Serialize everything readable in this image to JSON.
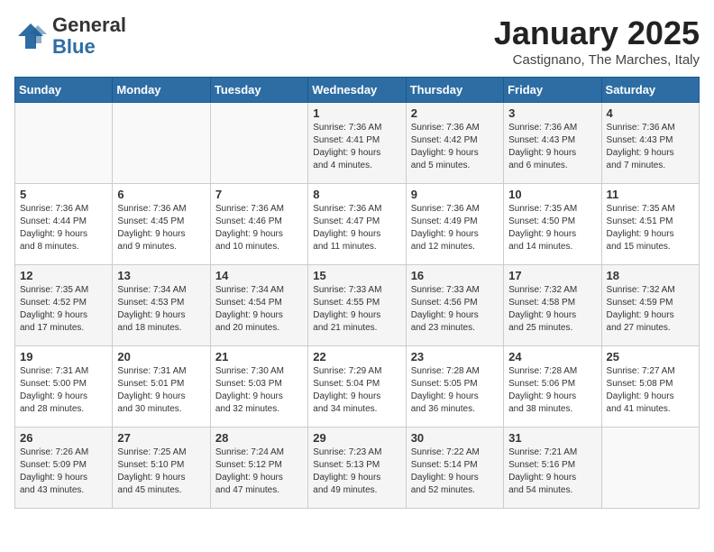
{
  "header": {
    "logo_general": "General",
    "logo_blue": "Blue",
    "month": "January 2025",
    "location": "Castignano, The Marches, Italy"
  },
  "weekdays": [
    "Sunday",
    "Monday",
    "Tuesday",
    "Wednesday",
    "Thursday",
    "Friday",
    "Saturday"
  ],
  "weeks": [
    [
      {
        "day": "",
        "text": ""
      },
      {
        "day": "",
        "text": ""
      },
      {
        "day": "",
        "text": ""
      },
      {
        "day": "1",
        "text": "Sunrise: 7:36 AM\nSunset: 4:41 PM\nDaylight: 9 hours\nand 4 minutes."
      },
      {
        "day": "2",
        "text": "Sunrise: 7:36 AM\nSunset: 4:42 PM\nDaylight: 9 hours\nand 5 minutes."
      },
      {
        "day": "3",
        "text": "Sunrise: 7:36 AM\nSunset: 4:43 PM\nDaylight: 9 hours\nand 6 minutes."
      },
      {
        "day": "4",
        "text": "Sunrise: 7:36 AM\nSunset: 4:43 PM\nDaylight: 9 hours\nand 7 minutes."
      }
    ],
    [
      {
        "day": "5",
        "text": "Sunrise: 7:36 AM\nSunset: 4:44 PM\nDaylight: 9 hours\nand 8 minutes."
      },
      {
        "day": "6",
        "text": "Sunrise: 7:36 AM\nSunset: 4:45 PM\nDaylight: 9 hours\nand 9 minutes."
      },
      {
        "day": "7",
        "text": "Sunrise: 7:36 AM\nSunset: 4:46 PM\nDaylight: 9 hours\nand 10 minutes."
      },
      {
        "day": "8",
        "text": "Sunrise: 7:36 AM\nSunset: 4:47 PM\nDaylight: 9 hours\nand 11 minutes."
      },
      {
        "day": "9",
        "text": "Sunrise: 7:36 AM\nSunset: 4:49 PM\nDaylight: 9 hours\nand 12 minutes."
      },
      {
        "day": "10",
        "text": "Sunrise: 7:35 AM\nSunset: 4:50 PM\nDaylight: 9 hours\nand 14 minutes."
      },
      {
        "day": "11",
        "text": "Sunrise: 7:35 AM\nSunset: 4:51 PM\nDaylight: 9 hours\nand 15 minutes."
      }
    ],
    [
      {
        "day": "12",
        "text": "Sunrise: 7:35 AM\nSunset: 4:52 PM\nDaylight: 9 hours\nand 17 minutes."
      },
      {
        "day": "13",
        "text": "Sunrise: 7:34 AM\nSunset: 4:53 PM\nDaylight: 9 hours\nand 18 minutes."
      },
      {
        "day": "14",
        "text": "Sunrise: 7:34 AM\nSunset: 4:54 PM\nDaylight: 9 hours\nand 20 minutes."
      },
      {
        "day": "15",
        "text": "Sunrise: 7:33 AM\nSunset: 4:55 PM\nDaylight: 9 hours\nand 21 minutes."
      },
      {
        "day": "16",
        "text": "Sunrise: 7:33 AM\nSunset: 4:56 PM\nDaylight: 9 hours\nand 23 minutes."
      },
      {
        "day": "17",
        "text": "Sunrise: 7:32 AM\nSunset: 4:58 PM\nDaylight: 9 hours\nand 25 minutes."
      },
      {
        "day": "18",
        "text": "Sunrise: 7:32 AM\nSunset: 4:59 PM\nDaylight: 9 hours\nand 27 minutes."
      }
    ],
    [
      {
        "day": "19",
        "text": "Sunrise: 7:31 AM\nSunset: 5:00 PM\nDaylight: 9 hours\nand 28 minutes."
      },
      {
        "day": "20",
        "text": "Sunrise: 7:31 AM\nSunset: 5:01 PM\nDaylight: 9 hours\nand 30 minutes."
      },
      {
        "day": "21",
        "text": "Sunrise: 7:30 AM\nSunset: 5:03 PM\nDaylight: 9 hours\nand 32 minutes."
      },
      {
        "day": "22",
        "text": "Sunrise: 7:29 AM\nSunset: 5:04 PM\nDaylight: 9 hours\nand 34 minutes."
      },
      {
        "day": "23",
        "text": "Sunrise: 7:28 AM\nSunset: 5:05 PM\nDaylight: 9 hours\nand 36 minutes."
      },
      {
        "day": "24",
        "text": "Sunrise: 7:28 AM\nSunset: 5:06 PM\nDaylight: 9 hours\nand 38 minutes."
      },
      {
        "day": "25",
        "text": "Sunrise: 7:27 AM\nSunset: 5:08 PM\nDaylight: 9 hours\nand 41 minutes."
      }
    ],
    [
      {
        "day": "26",
        "text": "Sunrise: 7:26 AM\nSunset: 5:09 PM\nDaylight: 9 hours\nand 43 minutes."
      },
      {
        "day": "27",
        "text": "Sunrise: 7:25 AM\nSunset: 5:10 PM\nDaylight: 9 hours\nand 45 minutes."
      },
      {
        "day": "28",
        "text": "Sunrise: 7:24 AM\nSunset: 5:12 PM\nDaylight: 9 hours\nand 47 minutes."
      },
      {
        "day": "29",
        "text": "Sunrise: 7:23 AM\nSunset: 5:13 PM\nDaylight: 9 hours\nand 49 minutes."
      },
      {
        "day": "30",
        "text": "Sunrise: 7:22 AM\nSunset: 5:14 PM\nDaylight: 9 hours\nand 52 minutes."
      },
      {
        "day": "31",
        "text": "Sunrise: 7:21 AM\nSunset: 5:16 PM\nDaylight: 9 hours\nand 54 minutes."
      },
      {
        "day": "",
        "text": ""
      }
    ]
  ]
}
